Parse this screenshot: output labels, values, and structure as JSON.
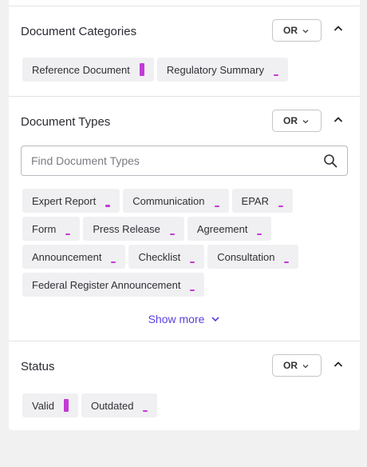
{
  "colors": {
    "accent_bar": "#c33ad6",
    "link": "#5b3ee0",
    "chip_bg": "#f0f0f2"
  },
  "categories": {
    "title": "Document Categories",
    "operator": "OR",
    "chips": [
      {
        "label": "Reference Document",
        "fill": 1.0
      },
      {
        "label": "Regulatory Summary",
        "fill": 0.15
      }
    ]
  },
  "types": {
    "title": "Document Types",
    "operator": "OR",
    "search_placeholder": "Find Document Types",
    "chips": [
      {
        "label": "Expert Report",
        "fill": 0.2
      },
      {
        "label": "Communication",
        "fill": 0.12
      },
      {
        "label": "EPAR",
        "fill": 0.12
      },
      {
        "label": "Form",
        "fill": 0.12
      },
      {
        "label": "Press Release",
        "fill": 0.12
      },
      {
        "label": "Agreement",
        "fill": 0.08
      },
      {
        "label": "Announcement",
        "fill": 0.08
      },
      {
        "label": "Checklist",
        "fill": 0.08
      },
      {
        "label": "Consultation",
        "fill": 0.08
      },
      {
        "label": "Federal Register Announcement",
        "fill": 0.08
      }
    ],
    "show_more_label": "Show more"
  },
  "status": {
    "title": "Status",
    "operator": "OR",
    "chips": [
      {
        "label": "Valid",
        "fill": 1.0
      },
      {
        "label": "Outdated",
        "fill": 0.12
      }
    ]
  }
}
